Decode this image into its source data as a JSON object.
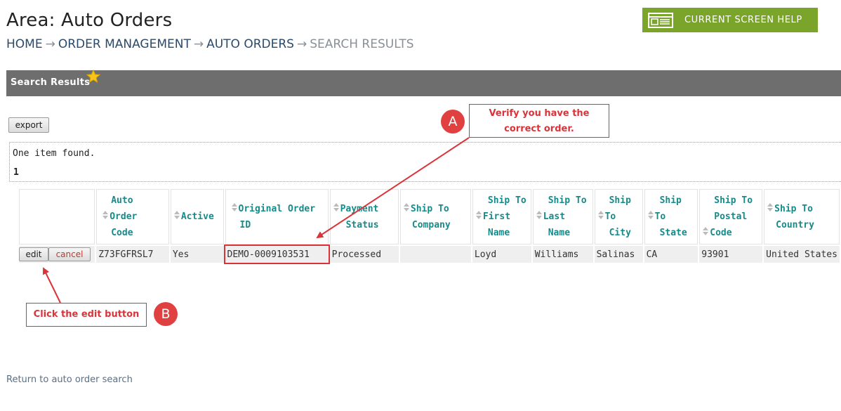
{
  "page": {
    "title": "Area: Auto Orders",
    "help_label": "CURRENT SCREEN HELP",
    "breadcrumb": [
      {
        "label": "HOME"
      },
      {
        "label": "ORDER MANAGEMENT"
      },
      {
        "label": "AUTO ORDERS"
      },
      {
        "label": "SEARCH RESULTS"
      }
    ],
    "breadcrumb_sep": "→"
  },
  "section": {
    "title": "Search Results"
  },
  "toolbar": {
    "export_label": "export"
  },
  "results": {
    "found_text": "One item found.",
    "page_number": "1",
    "columns": [
      "Auto Order Code",
      "Active",
      "Original Order ID",
      "Payment Status",
      "Ship To Company",
      "Ship To First Name",
      "Ship To Last Name",
      "Ship To City",
      "Ship To State",
      "Ship To Postal Code",
      "Ship To Country"
    ],
    "rows": [
      {
        "edit_label": "edit",
        "cancel_label": "cancel",
        "cells": [
          "Z73FGFRSL7",
          "Yes",
          "DEMO-0009103531",
          "Processed",
          "",
          "Loyd",
          "Williams",
          "Salinas",
          "CA",
          "93901",
          "United States"
        ]
      }
    ]
  },
  "annotations": {
    "a_badge": "A",
    "a_text_1": "Verify you have the",
    "a_text_2": "correct order.",
    "b_badge": "B",
    "b_text": "Click the edit button"
  },
  "footer": {
    "return_link": "Return to auto order search"
  },
  "colors": {
    "accent": "#7aa42a",
    "header_bar": "#6e6e6e",
    "column_header": "#178a8a",
    "annotation": "#d9343a"
  }
}
